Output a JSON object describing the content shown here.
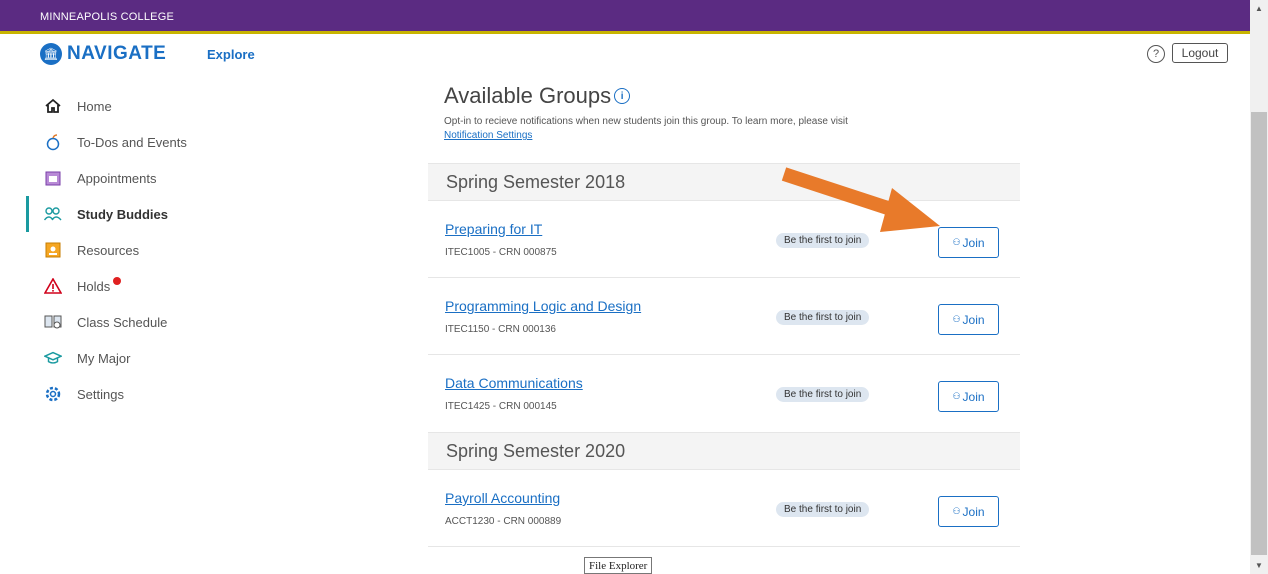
{
  "topbar": {
    "institution": "MINNEAPOLIS COLLEGE"
  },
  "header": {
    "logo_text": "NAVIGATE",
    "explore": "Explore",
    "help": "?",
    "logout": "Logout"
  },
  "sidebar": {
    "items": [
      {
        "label": "Home",
        "icon": "home-icon",
        "active": false
      },
      {
        "label": "To-Dos and Events",
        "icon": "apple-icon",
        "active": false
      },
      {
        "label": "Appointments",
        "icon": "calendar-icon",
        "active": false
      },
      {
        "label": "Study Buddies",
        "icon": "people-icon",
        "active": true
      },
      {
        "label": "Resources",
        "icon": "resources-icon",
        "active": false
      },
      {
        "label": "Holds",
        "icon": "warning-icon",
        "active": false
      },
      {
        "label": "Class Schedule",
        "icon": "book-icon",
        "active": false
      },
      {
        "label": "My Major",
        "icon": "graduation-cap-icon",
        "active": false
      },
      {
        "label": "Settings",
        "icon": "gear-icon",
        "active": false
      }
    ]
  },
  "main": {
    "title": "Available Groups",
    "description": "Opt-in to recieve notifications when new students join this group. To learn more, please visit",
    "settings_link": "Notification Settings",
    "semesters": [
      {
        "name": "Spring Semester 2018",
        "groups": [
          {
            "name": "Preparing for IT",
            "code": "ITEC1005 - CRN 000875",
            "status": "Be the first to join",
            "join_label": "Join"
          },
          {
            "name": "Programming Logic and Design",
            "code": "ITEC1150 - CRN 000136",
            "status": "Be the first to join",
            "join_label": "Join"
          },
          {
            "name": "Data Communications",
            "code": "ITEC1425 - CRN 000145",
            "status": "Be the first to join",
            "join_label": "Join"
          }
        ]
      },
      {
        "name": "Spring Semester 2020",
        "groups": [
          {
            "name": "Payroll Accounting",
            "code": "ACCT1230 - CRN 000889",
            "status": "Be the first to join",
            "join_label": "Join"
          }
        ]
      }
    ]
  },
  "tooltip": "File Explorer",
  "colors": {
    "topbar": "#5b2b82",
    "brand": "#1a6fc4",
    "active_accent": "#1a9aa0",
    "annotation_arrow": "#e87a2a",
    "hold_dot": "#e02020"
  }
}
